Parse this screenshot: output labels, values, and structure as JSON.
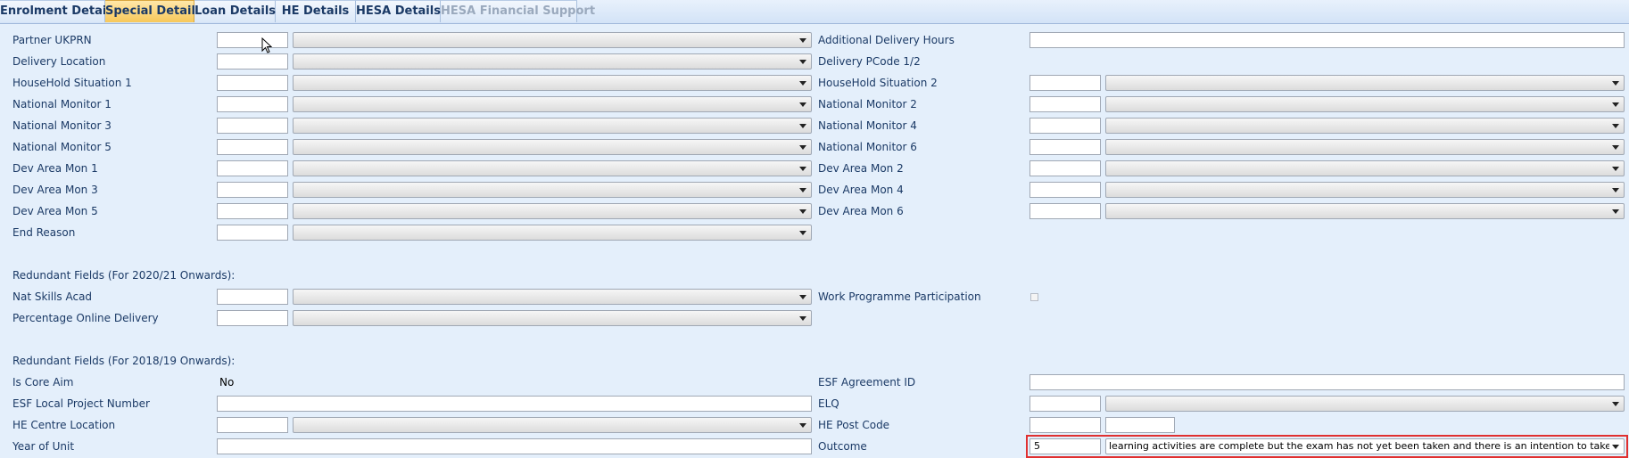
{
  "tabs": [
    {
      "label": "Enrolment Details",
      "state": "normal"
    },
    {
      "label": "Special Details",
      "state": "active"
    },
    {
      "label": "Loan Details",
      "state": "normal"
    },
    {
      "label": "HE Details",
      "state": "normal"
    },
    {
      "label": "HESA Details",
      "state": "normal"
    },
    {
      "label": "HESA Financial Support",
      "state": "disabled"
    }
  ],
  "left_fields": [
    "Partner UKPRN",
    "Delivery Location",
    "HouseHold Situation 1",
    "National Monitor 1",
    "National Monitor 3",
    "National Monitor 5",
    "Dev Area Mon 1",
    "Dev Area Mon 3",
    "Dev Area Mon 5",
    "End Reason"
  ],
  "right_fields": {
    "additional_delivery_hours": "Additional Delivery Hours",
    "delivery_pcode": "Delivery PCode 1/2",
    "paired": [
      "HouseHold Situation 2",
      "National Monitor 2",
      "National Monitor 4",
      "National Monitor 6",
      "Dev Area Mon 2",
      "Dev Area Mon 4",
      "Dev Area Mon 6"
    ]
  },
  "redundant_2020": {
    "heading": "Redundant Fields (For 2020/21 Onwards):",
    "nat_skills_acad": "Nat Skills Acad",
    "percentage_online_delivery": "Percentage Online Delivery",
    "work_programme_participation": "Work Programme Participation"
  },
  "redundant_2018": {
    "heading": "Redundant Fields (For 2018/19 Onwards):",
    "is_core_aim": "Is Core Aim",
    "is_core_aim_value": "No",
    "esf_local_project_number": "ESF Local Project Number",
    "he_centre_location": "HE Centre Location",
    "year_of_unit": "Year of Unit",
    "esf_agreement_id": "ESF Agreement ID",
    "elq": "ELQ",
    "he_post_code": "HE Post Code",
    "outcome": "Outcome",
    "outcome_code": "5",
    "outcome_text": "learning activities are complete but the exam has not yet been taken and there is an intention to take the"
  },
  "colors": {
    "background": "#e4effb",
    "label": "#1b3a66",
    "active_tab": "#f7c85a",
    "highlight": "#e03030"
  }
}
